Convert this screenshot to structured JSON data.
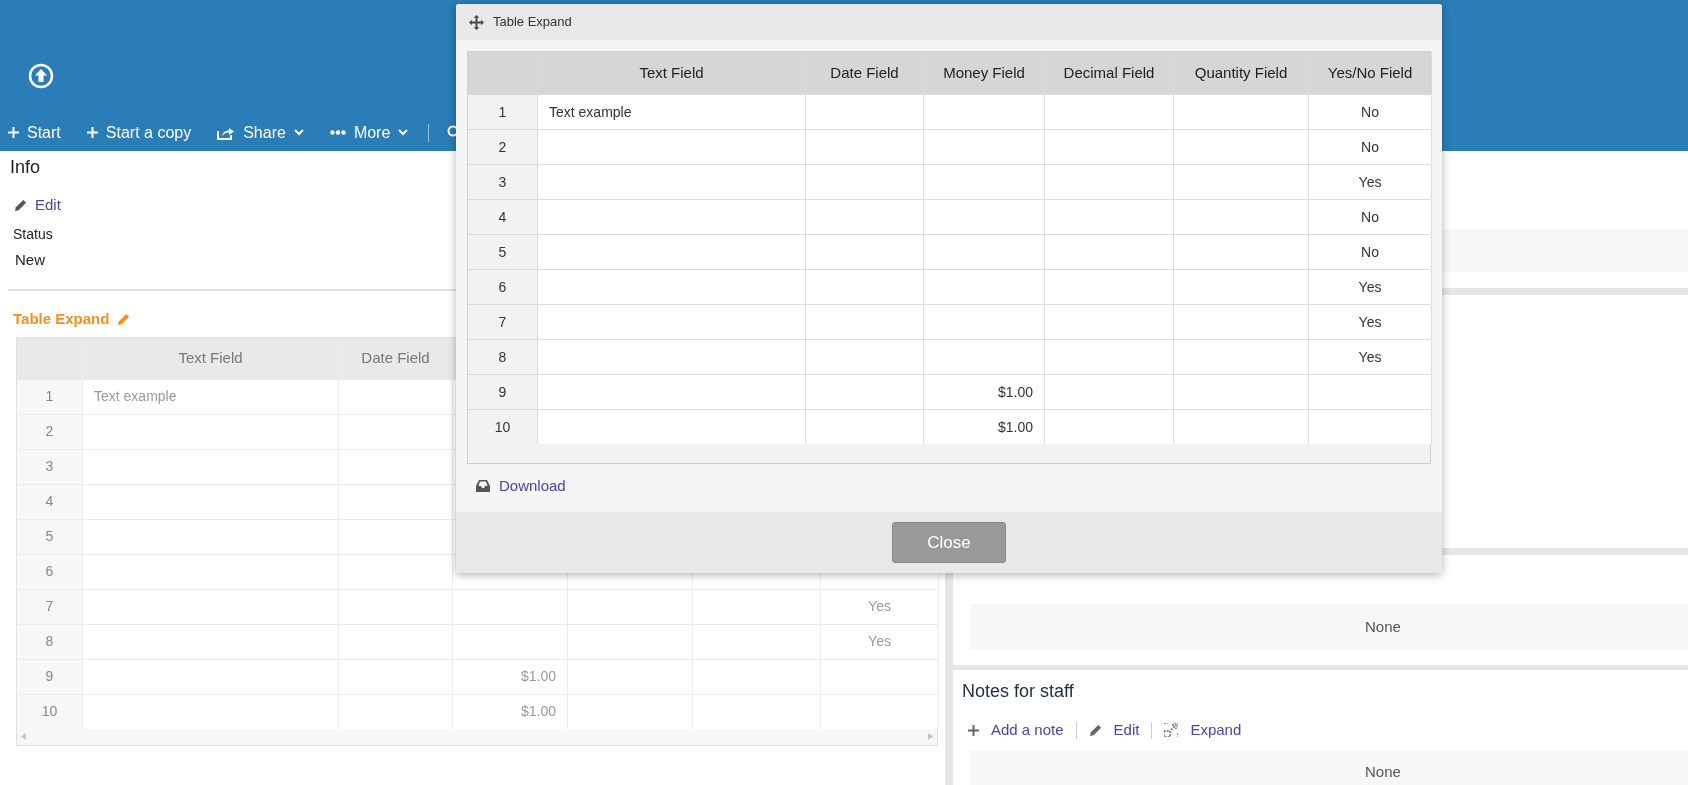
{
  "toolbar": [
    {
      "label": "Start",
      "kind": "plus",
      "dropdown": false
    },
    {
      "label": "Start a copy",
      "kind": "plus",
      "dropdown": false
    },
    {
      "label": "Share",
      "kind": "share",
      "dropdown": true
    },
    {
      "label": "More",
      "kind": "dots",
      "dropdown": true
    }
  ],
  "info": {
    "title": "Info",
    "edit": "Edit",
    "status_label": "Status",
    "status_value": "New"
  },
  "table_section": {
    "title": "Table Expand",
    "columns": [
      "Text Field",
      "Date Field"
    ],
    "rows": [
      {
        "number": "1",
        "cells": [
          "Text example",
          null
        ]
      },
      {
        "number": "2",
        "cells": [
          null,
          null
        ]
      },
      {
        "number": "3",
        "cells": [
          null,
          null
        ]
      },
      {
        "number": "4",
        "cells": [
          null,
          null
        ]
      },
      {
        "number": "5",
        "cells": [
          null,
          null
        ]
      },
      {
        "number": "6",
        "cells": [
          null,
          null
        ]
      },
      {
        "number": "7",
        "cells": [
          null,
          null,
          null,
          null,
          null,
          "Yes"
        ]
      },
      {
        "number": "8",
        "cells": [
          null,
          null,
          null,
          null,
          null,
          "Yes"
        ]
      },
      {
        "number": "9",
        "cells": [
          null,
          null,
          "$1.00",
          null,
          null,
          null
        ]
      },
      {
        "number": "10",
        "cells": [
          null,
          null,
          "$1.00",
          null,
          null,
          null
        ]
      }
    ]
  },
  "referenced_in": {
    "value": "None"
  },
  "notes": {
    "title": "Notes for staff",
    "actions": [
      {
        "label": "Add a note",
        "kind": "plus"
      },
      {
        "label": "Edit",
        "kind": "pencil"
      },
      {
        "label": "Expand",
        "kind": "expand"
      }
    ],
    "value": "None"
  },
  "modal": {
    "title": "Table Expand",
    "columns": [
      "Text Field",
      "Date Field",
      "Money Field",
      "Decimal Field",
      "Quantity Field",
      "Yes/No Field"
    ],
    "rows": [
      {
        "number": "1",
        "cells": [
          "Text example",
          null,
          null,
          null,
          null,
          "No"
        ]
      },
      {
        "number": "2",
        "cells": [
          null,
          null,
          null,
          null,
          null,
          "No"
        ]
      },
      {
        "number": "3",
        "cells": [
          null,
          null,
          null,
          null,
          null,
          "Yes"
        ]
      },
      {
        "number": "4",
        "cells": [
          null,
          null,
          null,
          null,
          null,
          "No"
        ]
      },
      {
        "number": "5",
        "cells": [
          null,
          null,
          null,
          null,
          null,
          "No"
        ]
      },
      {
        "number": "6",
        "cells": [
          null,
          null,
          null,
          null,
          null,
          "Yes"
        ]
      },
      {
        "number": "7",
        "cells": [
          null,
          null,
          null,
          null,
          null,
          "Yes"
        ]
      },
      {
        "number": "8",
        "cells": [
          null,
          null,
          null,
          null,
          null,
          "Yes"
        ]
      },
      {
        "number": "9",
        "cells": [
          null,
          null,
          "$1.00",
          null,
          null,
          null
        ]
      },
      {
        "number": "10",
        "cells": [
          null,
          null,
          "$1.00",
          null,
          null,
          null
        ]
      }
    ],
    "download": "Download",
    "close": "Close"
  }
}
